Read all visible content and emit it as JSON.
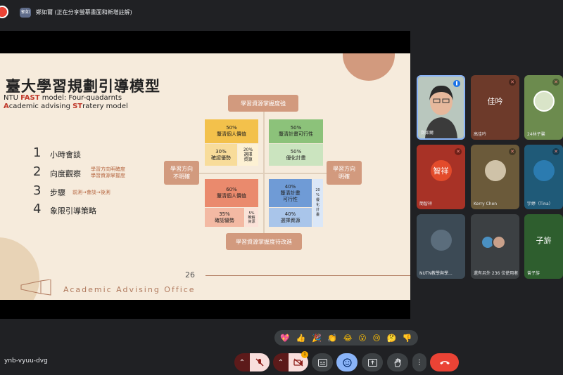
{
  "banner": {
    "presenter_initials": "郭如",
    "text": "鄭如爾 (正在分享螢幕畫面和新增註解)"
  },
  "slide": {
    "title": "臺大學習規劃引導模型",
    "subtitle_line1_pre": "NTU ",
    "subtitle_line1_bold": "FAST",
    "subtitle_line1_post": " model: Four-quadarnts",
    "subtitle_line2_a": "A",
    "subtitle_line2_b": "cademic advising ",
    "subtitle_line2_c": "ST",
    "subtitle_line2_d": "ratery model",
    "list": [
      {
        "num": "1",
        "text": "小時會談"
      },
      {
        "num": "2",
        "text": "向度觀察"
      },
      {
        "num": "3",
        "text": "步驟"
      },
      {
        "num": "4",
        "text": "象限引導策略"
      }
    ],
    "notes": {
      "item2_line1": "學習方向明確度",
      "item2_line2": "學習資源掌握度",
      "item3": "前測→會談→後測"
    },
    "axis_labels": {
      "top": "學習資源掌握度強",
      "bottom": "學習資源掌握度待改進",
      "left": "學習方向\n不明確",
      "right": "學習方向\n明確"
    },
    "quadrants": {
      "tl_main": "50%\n釐清個人價值",
      "tl_sub1": "30%\n確認優勢",
      "tl_sub2": "20%\n選擇\n資源",
      "tr_main": "50%\n釐清計畫可行性",
      "tr_sub": "50%\n優化計畫",
      "bl_main": "60%\n釐清個人價值",
      "bl_sub1": "35%\n確認優勢",
      "bl_sub2": "5%\n瞭解\n資源",
      "br_main": "40%\n釐清計畫\n可行性",
      "br_sub1": "40%\n選擇資源",
      "br_sub2": "20\n%\n優\n化\n計\n畫"
    },
    "page_number": "26",
    "footer": "Academic Advising Office"
  },
  "participants": [
    {
      "name": "鄭如爾",
      "type": "video"
    },
    {
      "name": "高佳吟",
      "avatar": "佳吟",
      "color": "#6d3a2a"
    },
    {
      "name": "24林子馨",
      "type": "image"
    },
    {
      "name": "智祥",
      "avatar": "智祥",
      "color": "#c0392b"
    },
    {
      "name": "Kerry Chen",
      "type": "image"
    },
    {
      "name": "宇婷（Tina）",
      "type": "image"
    },
    {
      "name": "NUTN教學與學...",
      "type": "image"
    },
    {
      "name": "還有另外 236 位使用者",
      "type": "group"
    },
    {
      "name": "曾子旂",
      "avatar": "子旂",
      "color": "#2e5e2e"
    }
  ],
  "tile_names": {
    "t4": "簡智祥"
  },
  "reactions": [
    "💖",
    "👍",
    "🎉",
    "👏",
    "😂",
    "😮",
    "😢",
    "🤔",
    "👎"
  ],
  "meeting_code": "ynb-vyuu-dvg",
  "controls": {
    "badge_count": "1"
  }
}
